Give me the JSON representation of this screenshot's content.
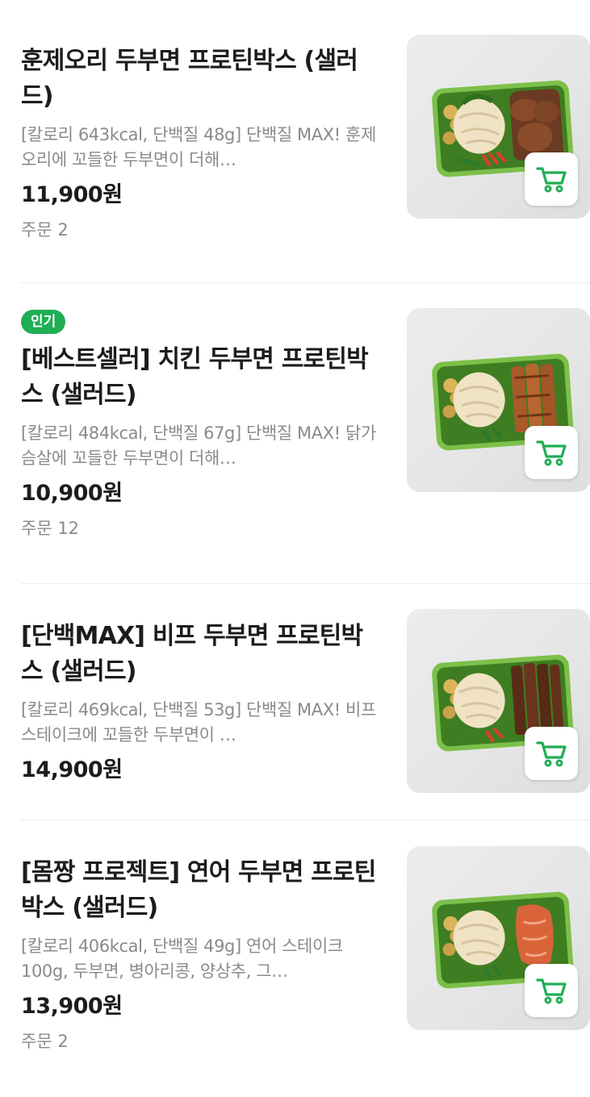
{
  "colors": {
    "accent": "#1fae54",
    "title": "#1c1c1c",
    "muted": "#8a8a8a",
    "divider": "#ececec"
  },
  "items": [
    {
      "title": "훈제오리 두부면 프로틴박스 (샐러드)",
      "description": "[칼로리 643kcal, 단백질 48g] 단백질 MAX! 훈제오리에 꼬들한 두부면이 더해…",
      "price": "11,900원",
      "orders": "주문 2",
      "badge": "",
      "image_icon": "duck-tofu-noodle-salad-image",
      "cart_icon": "cart-icon"
    },
    {
      "title": "[베스트셀러] 치킨 두부면 프로틴박스 (샐러드)",
      "description": "[칼로리 484kcal, 단백질 67g] 단백질 MAX! 닭가슴살에 꼬들한 두부면이 더해…",
      "price": "10,900원",
      "orders": "주문 12",
      "badge": "인기",
      "image_icon": "chicken-tofu-noodle-salad-image",
      "cart_icon": "cart-icon"
    },
    {
      "title": "[단백MAX] 비프 두부면 프로틴박스 (샐러드)",
      "description": "[칼로리 469kcal, 단백질 53g] 단백질 MAX! 비프 스테이크에 꼬들한 두부면이 …",
      "price": "14,900원",
      "orders": "",
      "badge": "",
      "image_icon": "beef-tofu-noodle-salad-image",
      "cart_icon": "cart-icon"
    },
    {
      "title": "[몸짱 프로젝트] 연어 두부면 프로틴박스 (샐러드)",
      "description": "[칼로리 406kcal, 단백질 49g] 연어 스테이크 100g, 두부면, 병아리콩, 양상추, 그…",
      "price": "13,900원",
      "orders": "주문 2",
      "badge": "",
      "image_icon": "salmon-tofu-noodle-salad-image",
      "cart_icon": "cart-icon"
    }
  ]
}
